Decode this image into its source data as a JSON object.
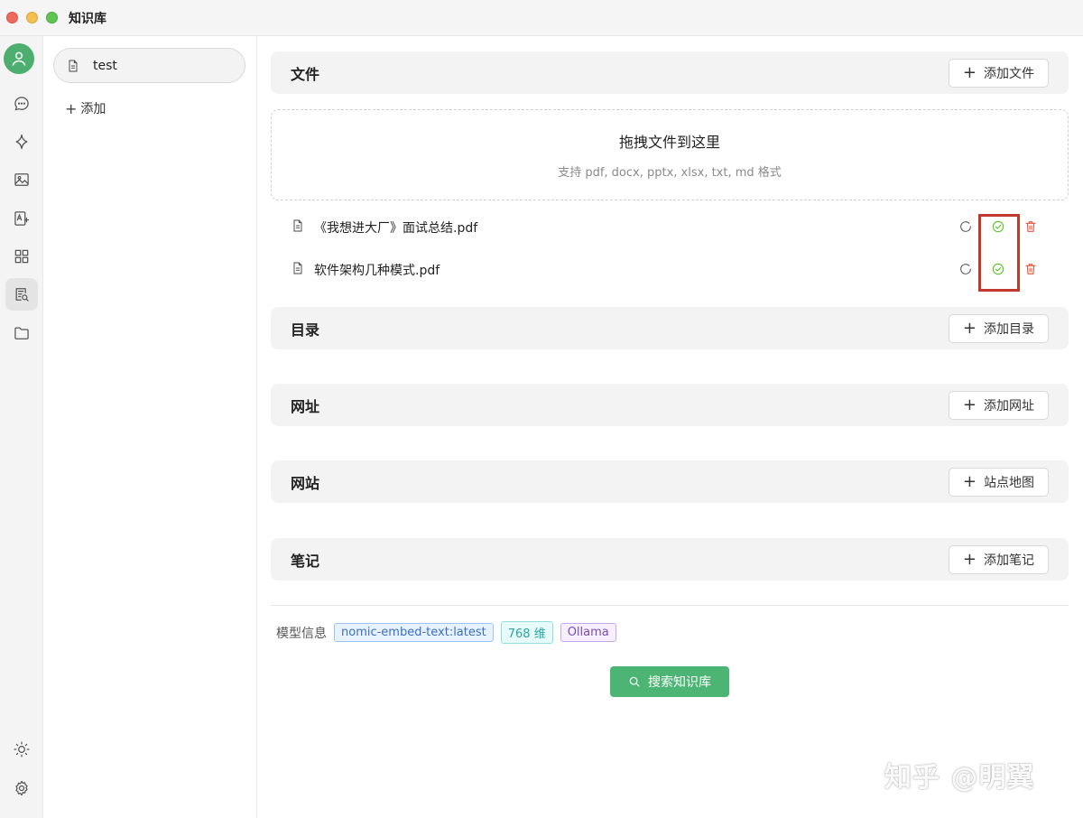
{
  "window": {
    "title": "知识库"
  },
  "rail": {
    "items": [
      {
        "name": "chat-icon"
      },
      {
        "name": "sparkle-icon"
      },
      {
        "name": "image-icon"
      },
      {
        "name": "translate-icon"
      },
      {
        "name": "apps-grid-icon"
      },
      {
        "name": "knowledge-base-icon",
        "active": true
      },
      {
        "name": "folder-icon"
      }
    ],
    "bottom": [
      {
        "name": "theme-sun-icon"
      },
      {
        "name": "settings-gear-icon"
      }
    ]
  },
  "kb_list": {
    "items": [
      {
        "label": "test",
        "selected": true
      }
    ],
    "add_label": "添加"
  },
  "sections": {
    "files": {
      "title": "文件",
      "button": "添加文件"
    },
    "directory": {
      "title": "目录",
      "button": "添加目录"
    },
    "urls": {
      "title": "网址",
      "button": "添加网址"
    },
    "websites": {
      "title": "网站",
      "button": "站点地图"
    },
    "notes": {
      "title": "笔记",
      "button": "添加笔记"
    }
  },
  "dropzone": {
    "title": "拖拽文件到这里",
    "subtitle": "支持 pdf, docx, pptx, xlsx, txt, md 格式"
  },
  "files": [
    {
      "name": "《我想进大厂》面试总结.pdf",
      "status": "done"
    },
    {
      "name": "软件架构几种模式.pdf",
      "status": "done"
    }
  ],
  "model_info": {
    "label": "模型信息",
    "model": "nomic-embed-text:latest",
    "dimensions": "768 维",
    "provider": "Ollama"
  },
  "search_button": "搜索知识库",
  "watermark": "知乎 @明翼",
  "colors": {
    "accent": "#4cb573",
    "check": "#52c41a",
    "delete": "#e5533c",
    "highlight": "#c0392b"
  }
}
